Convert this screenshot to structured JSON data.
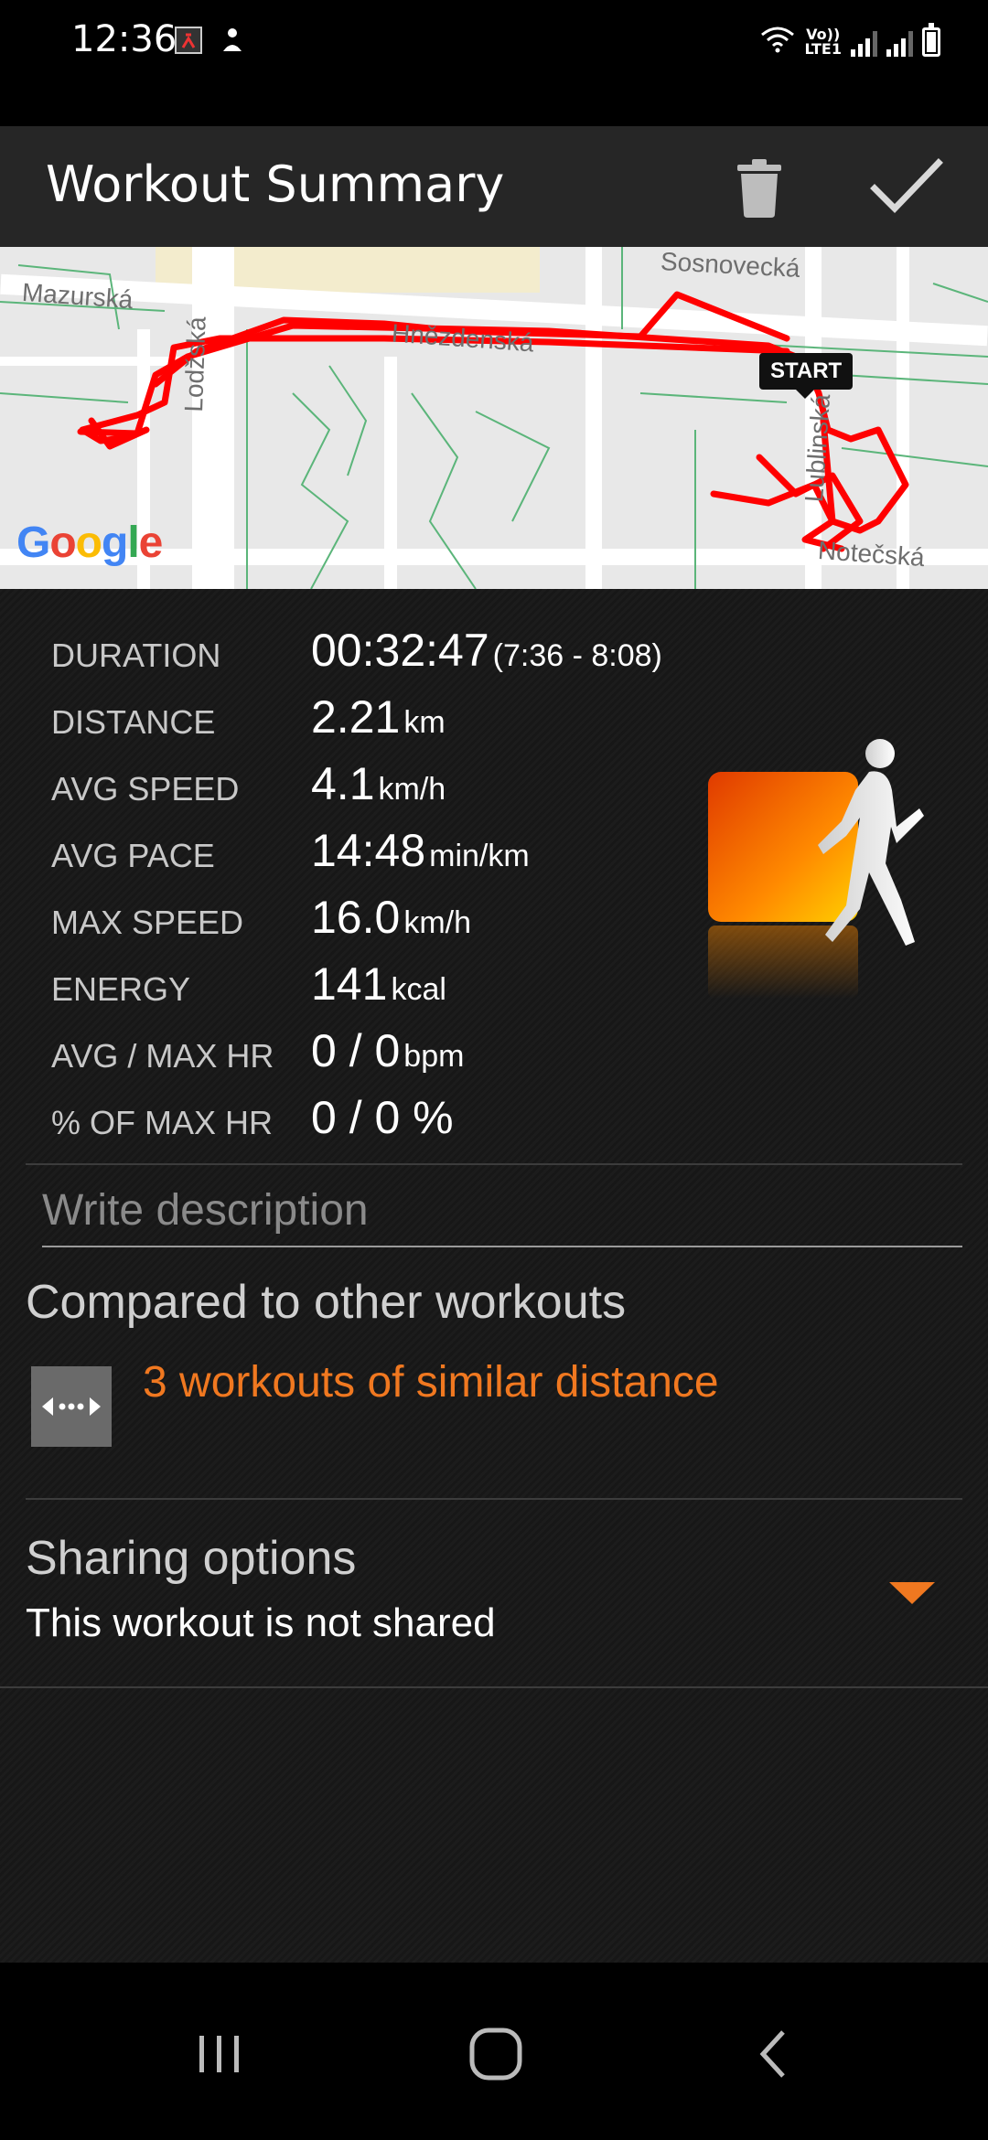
{
  "status_bar": {
    "time": "12:36",
    "network_label": "Vo))\nLTE1"
  },
  "app_bar": {
    "title": "Workout Summary",
    "icons": [
      "trash-icon",
      "check-icon"
    ]
  },
  "map": {
    "streets": [
      "Mazurská",
      "Lodžská",
      "Hnězdenská",
      "Sosnovecká",
      "Lublinská",
      "Notečská"
    ],
    "start_label": "START",
    "provider": "Google",
    "route_color": "#ff0000"
  },
  "stats": [
    {
      "label": "DURATION",
      "value": "00:32:47",
      "unit": "",
      "extra": "(7:36 - 8:08)"
    },
    {
      "label": "DISTANCE",
      "value": "2.21",
      "unit": "km",
      "extra": ""
    },
    {
      "label": "AVG SPEED",
      "value": "4.1",
      "unit": "km/h",
      "extra": ""
    },
    {
      "label": "AVG PACE",
      "value": "14:48",
      "unit": "min/km",
      "extra": ""
    },
    {
      "label": "MAX SPEED",
      "value": "16.0",
      "unit": "km/h",
      "extra": ""
    },
    {
      "label": "ENERGY",
      "value": "141",
      "unit": "kcal",
      "extra": ""
    },
    {
      "label": "AVG / MAX HR",
      "value": "0 / 0",
      "unit": "bpm",
      "extra": ""
    },
    {
      "label": "% OF MAX HR",
      "value": "0 / 0 %",
      "unit": "",
      "extra": ""
    }
  ],
  "sport_icon": "walking-icon",
  "description": {
    "placeholder": "Write description"
  },
  "compare": {
    "title": "Compared to other workouts",
    "link": "3 workouts of similar distance",
    "icon": "distance-arrows-icon",
    "link_color": "#f07820"
  },
  "sharing": {
    "title": "Sharing options",
    "status": "This workout is not shared",
    "icon": "dropdown-triangle-icon",
    "accent": "#f07820"
  },
  "nav_bar": {
    "icons": [
      "recent-apps-icon",
      "home-icon",
      "back-icon"
    ]
  }
}
